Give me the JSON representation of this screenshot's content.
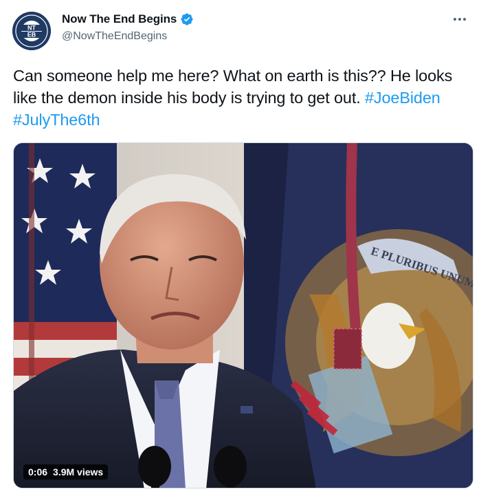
{
  "account": {
    "display_name": "Now The End Begins",
    "handle": "@NowTheEndBegins",
    "avatar_initials_top": "NT",
    "avatar_initials_bottom": "EB",
    "avatar_ring_text": "KING JAMES BIBLE BELIEVERS SINCE 2008"
  },
  "tweet": {
    "text": "Can someone help me here? What on earth is this?? He looks like the demon inside his body is trying to get out. ",
    "hashtags": [
      "#JoeBiden",
      "#JulyThe6th"
    ]
  },
  "video": {
    "time": "0:06",
    "views": "3.9M views",
    "seal_text": "E PLURIBUS UNUM"
  },
  "icons": {
    "verified": "verified-badge-icon",
    "more": "more-options-icon"
  },
  "colors": {
    "link": "#1d9bf0",
    "secondary_text": "#536471",
    "verified": "#1d9bf0"
  }
}
